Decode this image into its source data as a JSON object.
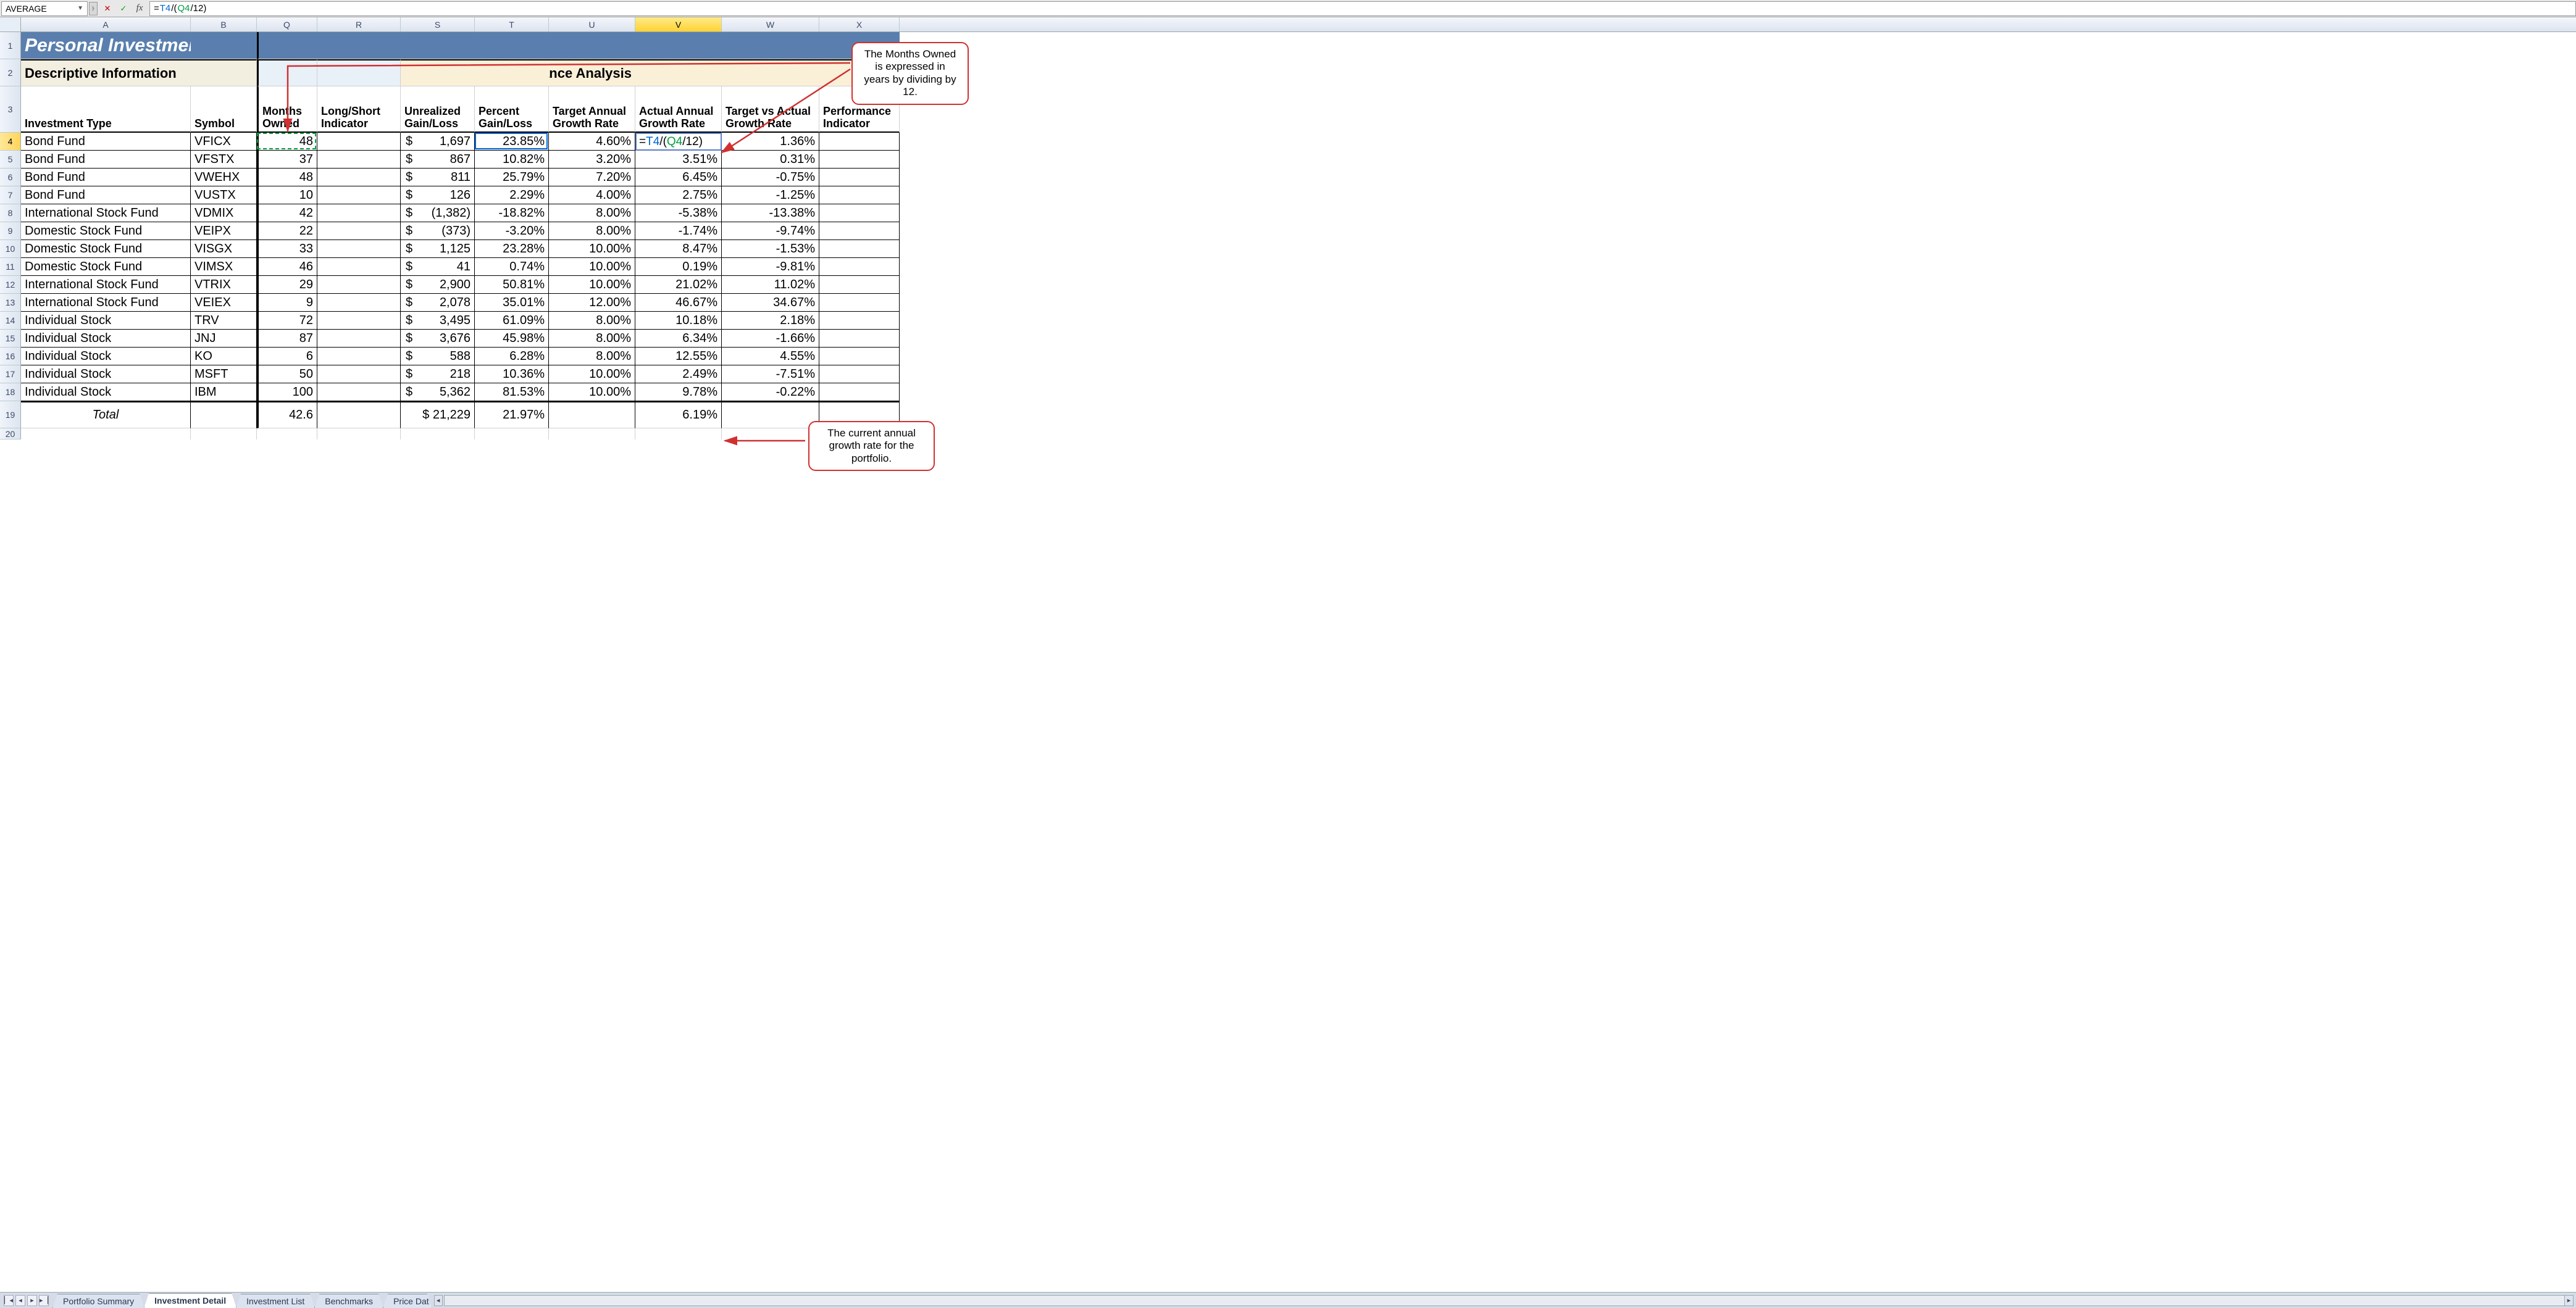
{
  "formula_bar": {
    "name_box": "AVERAGE",
    "formula": "=T4/(Q4/12)",
    "formula_parts": {
      "eq": "=",
      "t4": "T4",
      "div": "/",
      "open": "(",
      "q4": "Q4",
      "div2": "/12)",
      "close": ""
    }
  },
  "columns": [
    "A",
    "B",
    "Q",
    "R",
    "S",
    "T",
    "U",
    "V",
    "W",
    "X"
  ],
  "row_numbers": [
    "1",
    "2",
    "3",
    "4",
    "5",
    "6",
    "7",
    "8",
    "9",
    "10",
    "11",
    "12",
    "13",
    "14",
    "15",
    "16",
    "17",
    "18",
    "19",
    "20"
  ],
  "title": "Personal Investment",
  "section_headers": {
    "descriptive": "Descriptive Information",
    "performance": "Performance Analysis"
  },
  "col_labels": {
    "A": "Investment Type",
    "B": "Symbol",
    "Q": "Months Owned",
    "R": "Long/Short Indicator",
    "S": "Unrealized Gain/Loss",
    "T": "Percent Gain/Loss",
    "U": "Target Annual Growth Rate",
    "V": "Actual Annual Growth Rate",
    "W": "Target vs Actual Growth Rate",
    "X": "Performance Indicator"
  },
  "rows": [
    {
      "type": "Bond Fund",
      "sym": "VFICX",
      "months": "48",
      "s": "1,697",
      "t": "23.85%",
      "u": "4.60%",
      "v_edit": "=T4/(Q4/12)",
      "w": "1.36%"
    },
    {
      "type": "Bond Fund",
      "sym": "VFSTX",
      "months": "37",
      "s": "867",
      "t": "10.82%",
      "u": "3.20%",
      "v": "3.51%",
      "w": "0.31%"
    },
    {
      "type": "Bond Fund",
      "sym": "VWEHX",
      "months": "48",
      "s": "811",
      "t": "25.79%",
      "u": "7.20%",
      "v": "6.45%",
      "w": "-0.75%"
    },
    {
      "type": "Bond Fund",
      "sym": "VUSTX",
      "months": "10",
      "s": "126",
      "t": "2.29%",
      "u": "4.00%",
      "v": "2.75%",
      "w": "-1.25%"
    },
    {
      "type": "International Stock Fund",
      "sym": "VDMIX",
      "months": "42",
      "s": "(1,382)",
      "t": "-18.82%",
      "u": "8.00%",
      "v": "-5.38%",
      "w": "-13.38%"
    },
    {
      "type": "Domestic Stock Fund",
      "sym": "VEIPX",
      "months": "22",
      "s": "(373)",
      "t": "-3.20%",
      "u": "8.00%",
      "v": "-1.74%",
      "w": "-9.74%"
    },
    {
      "type": "Domestic Stock Fund",
      "sym": "VISGX",
      "months": "33",
      "s": "1,125",
      "t": "23.28%",
      "u": "10.00%",
      "v": "8.47%",
      "w": "-1.53%"
    },
    {
      "type": "Domestic Stock Fund",
      "sym": "VIMSX",
      "months": "46",
      "s": "41",
      "t": "0.74%",
      "u": "10.00%",
      "v": "0.19%",
      "w": "-9.81%"
    },
    {
      "type": "International Stock Fund",
      "sym": "VTRIX",
      "months": "29",
      "s": "2,900",
      "t": "50.81%",
      "u": "10.00%",
      "v": "21.02%",
      "w": "11.02%"
    },
    {
      "type": "International Stock Fund",
      "sym": "VEIEX",
      "months": "9",
      "s": "2,078",
      "t": "35.01%",
      "u": "12.00%",
      "v": "46.67%",
      "w": "34.67%"
    },
    {
      "type": "Individual Stock",
      "sym": "TRV",
      "months": "72",
      "s": "3,495",
      "t": "61.09%",
      "u": "8.00%",
      "v": "10.18%",
      "w": "2.18%"
    },
    {
      "type": "Individual Stock",
      "sym": "JNJ",
      "months": "87",
      "s": "3,676",
      "t": "45.98%",
      "u": "8.00%",
      "v": "6.34%",
      "w": "-1.66%"
    },
    {
      "type": "Individual Stock",
      "sym": "KO",
      "months": "6",
      "s": "588",
      "t": "6.28%",
      "u": "8.00%",
      "v": "12.55%",
      "w": "4.55%"
    },
    {
      "type": "Individual Stock",
      "sym": "MSFT",
      "months": "50",
      "s": "218",
      "t": "10.36%",
      "u": "10.00%",
      "v": "2.49%",
      "w": "-7.51%"
    },
    {
      "type": "Individual Stock",
      "sym": "IBM",
      "months": "100",
      "s": "5,362",
      "t": "81.53%",
      "u": "10.00%",
      "v": "9.78%",
      "w": "-0.22%"
    }
  ],
  "total": {
    "label": "Total",
    "months": "42.6",
    "s": "$ 21,229",
    "t": "21.97%",
    "v": "6.19%"
  },
  "tabs": [
    "Portfolio Summary",
    "Investment Detail",
    "Investment List",
    "Benchmarks",
    "Price Dat"
  ],
  "active_tab": 1,
  "callouts": {
    "top": "The Months Owned is expressed in years by dividing by 12.",
    "bottom": "The current annual growth rate for the portfolio."
  }
}
